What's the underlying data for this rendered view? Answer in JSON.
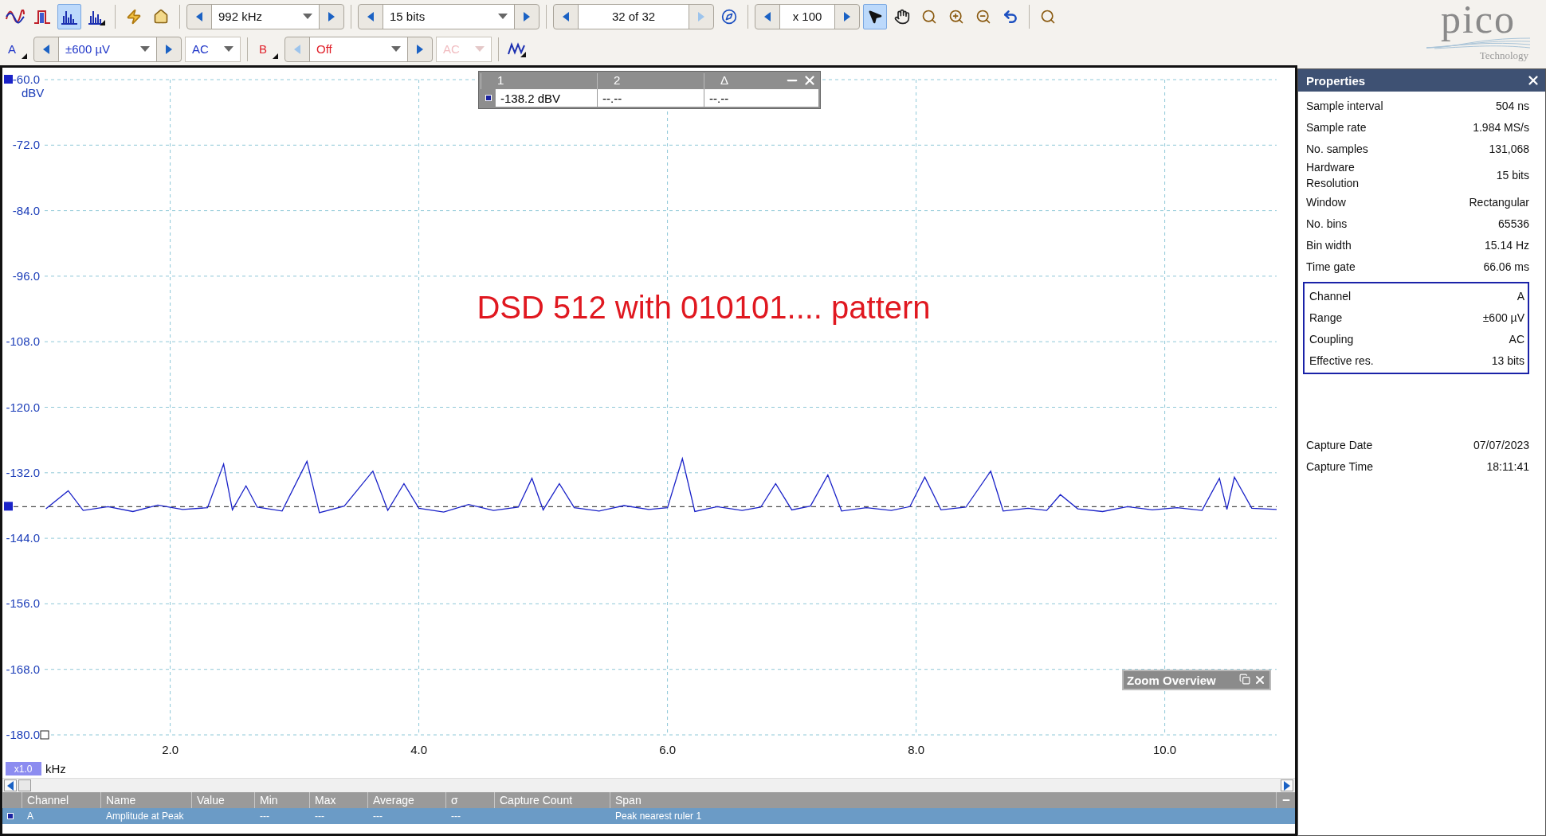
{
  "toolbar": {
    "view_modes": [
      {
        "kind": "scope",
        "selected": false
      },
      {
        "kind": "persistence",
        "selected": false
      },
      {
        "kind": "spectrum",
        "selected": true
      },
      {
        "kind": "spectrum_options",
        "selected": false
      }
    ],
    "actions": [
      {
        "kind": "lightning"
      },
      {
        "kind": "home"
      }
    ],
    "spinners": [
      {
        "value": "992 kHz",
        "dropdown": true,
        "prev_disabled": false,
        "next_disabled": false
      },
      {
        "value": "15 bits",
        "dropdown": true,
        "prev_disabled": false,
        "next_disabled": false
      },
      {
        "value": "32 of 32",
        "dropdown": false,
        "prev_disabled": false,
        "next_disabled": true
      },
      {
        "value": "x 100",
        "dropdown": false,
        "prev_disabled": false,
        "next_disabled": false
      }
    ],
    "tools": [
      {
        "kind": "pointer",
        "selected": true
      },
      {
        "kind": "hand",
        "selected": false
      },
      {
        "kind": "zoom_fit",
        "selected": false
      },
      {
        "kind": "zoom_in",
        "selected": false
      },
      {
        "kind": "zoom_out",
        "selected": false
      },
      {
        "kind": "undo",
        "selected": false
      },
      {
        "kind": "zoom_100",
        "selected": false
      }
    ]
  },
  "channel_bar": {
    "channels": [
      {
        "name": "A",
        "color": "#1f35c8",
        "range": {
          "value": "±600 µV",
          "dropdown": true,
          "prev_disabled": false,
          "next_disabled": false
        },
        "coupling": {
          "value": "AC",
          "disabled": false
        }
      },
      {
        "name": "B",
        "color": "#e0202a",
        "range": {
          "value": "Off",
          "dropdown": true,
          "prev_disabled": true,
          "next_disabled": false
        },
        "coupling": {
          "value": "AC",
          "disabled": true
        }
      }
    ]
  },
  "logo": {
    "name": "pico",
    "tagline": "Technology"
  },
  "chart": {
    "chart_data": {
      "type": "line",
      "xlabel": "kHz",
      "ylabel": "dBV",
      "xlim": [
        0.99,
        10.9
      ],
      "ylim": [
        -180,
        -60
      ],
      "xticks": [
        {
          "value": 2,
          "label": "2.0"
        },
        {
          "value": 4,
          "label": "4.0"
        },
        {
          "value": 6,
          "label": "6.0"
        },
        {
          "value": 8,
          "label": "8.0"
        },
        {
          "value": 10,
          "label": "10.0"
        }
      ],
      "yticks": [
        {
          "value": -60,
          "label": "-60.0"
        },
        {
          "value": -72,
          "label": "-72.0"
        },
        {
          "value": -84,
          "label": "-84.0"
        },
        {
          "value": -96,
          "label": "-96.0"
        },
        {
          "value": -108,
          "label": "-108.0"
        },
        {
          "value": -120,
          "label": "-120.0"
        },
        {
          "value": -132,
          "label": "-132.0"
        },
        {
          "value": -144,
          "label": "-144.0"
        },
        {
          "value": -156,
          "label": "-156.0"
        },
        {
          "value": -168,
          "label": "-168.0"
        },
        {
          "value": -180,
          "label": "-180.0"
        }
      ],
      "x": [
        1.0,
        1.18,
        1.3,
        1.5,
        1.7,
        1.9,
        2.1,
        2.3,
        2.43,
        2.5,
        2.61,
        2.7,
        2.9,
        3.1,
        3.2,
        3.4,
        3.63,
        3.75,
        3.88,
        4.0,
        4.2,
        4.4,
        4.6,
        4.8,
        4.91,
        5.0,
        5.13,
        5.25,
        5.45,
        5.65,
        5.85,
        6.0,
        6.12,
        6.22,
        6.4,
        6.6,
        6.75,
        6.87,
        7.0,
        7.15,
        7.29,
        7.4,
        7.6,
        7.8,
        7.95,
        8.07,
        8.2,
        8.4,
        8.6,
        8.7,
        8.9,
        9.05,
        9.16,
        9.3,
        9.5,
        9.7,
        9.9,
        10.1,
        10.3,
        10.44,
        10.5,
        10.56,
        10.7,
        10.9
      ],
      "series": [
        {
          "color": "#1a22c8",
          "values": [
            -138.6,
            -135.3,
            -138.9,
            -138.2,
            -139.1,
            -137.9,
            -138.7,
            -138.4,
            -130.4,
            -138.8,
            -134.4,
            -138.3,
            -139.0,
            -129.9,
            -139.3,
            -138.1,
            -131.7,
            -138.9,
            -134.0,
            -138.5,
            -139.2,
            -137.8,
            -138.9,
            -138.3,
            -133.0,
            -138.8,
            -134.0,
            -138.4,
            -139.0,
            -138.0,
            -138.7,
            -138.4,
            -129.4,
            -139.1,
            -138.2,
            -138.9,
            -138.3,
            -134.0,
            -138.8,
            -138.1,
            -132.4,
            -139.0,
            -138.4,
            -138.9,
            -138.2,
            -132.8,
            -138.8,
            -138.3,
            -131.7,
            -139.0,
            -138.5,
            -138.9,
            -136.0,
            -138.6,
            -139.1,
            -138.2,
            -138.8,
            -138.4,
            -138.9,
            -133.0,
            -138.7,
            -132.8,
            -138.5,
            -138.7
          ]
        }
      ],
      "grid": true,
      "ref_lines": [
        {
          "axis": "y",
          "value": -138.2
        }
      ],
      "annotations": [
        "DSD 512 with 010101.... pattern"
      ]
    },
    "zoom_badge": "x1.0"
  },
  "ruler_table": {
    "columns": [
      "1",
      "2",
      "Δ"
    ],
    "values": [
      "-138.2 dBV",
      "--.--",
      "--.--"
    ]
  },
  "zoom_overview": {
    "title": "Zoom Overview"
  },
  "measurements": {
    "columns": [
      "Channel",
      "Name",
      "Value",
      "Min",
      "Max",
      "Average",
      "σ",
      "Capture Count",
      "Span"
    ],
    "rows": [
      {
        "selected": true,
        "cells": [
          "A",
          "Amplitude at Peak",
          null,
          "---",
          "---",
          "---",
          "---",
          null,
          "Peak nearest ruler 1"
        ]
      }
    ]
  },
  "properties": {
    "title": "Properties",
    "general": [
      {
        "label": "Sample interval",
        "value": "504 ns"
      },
      {
        "label": "Sample rate",
        "value": "1.984 MS/s"
      },
      {
        "label": "No. samples",
        "value": "131,068"
      },
      {
        "label": "Hardware Resolution",
        "value": "15 bits"
      },
      {
        "label": "Window",
        "value": "Rectangular"
      },
      {
        "label": "No. bins",
        "value": "65536"
      },
      {
        "label": "Bin width",
        "value": "15.14 Hz"
      },
      {
        "label": "Time gate",
        "value": "66.06 ms"
      }
    ],
    "channel": [
      {
        "label": "Channel",
        "value": "A"
      },
      {
        "label": "Range",
        "value": "±600 µV"
      },
      {
        "label": "Coupling",
        "value": "AC"
      },
      {
        "label": "Effective res.",
        "value": "13 bits"
      }
    ],
    "capture": [
      {
        "label": "Capture Date",
        "value": "07/07/2023"
      },
      {
        "label": "Capture Time",
        "value": "18:11:41"
      }
    ]
  }
}
